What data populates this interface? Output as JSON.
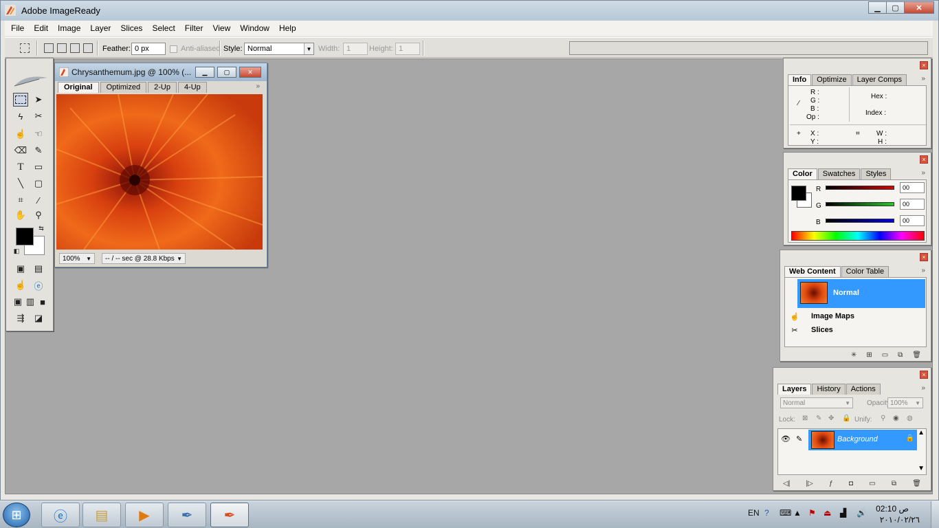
{
  "app": {
    "title": "Adobe ImageReady"
  },
  "window_controls": {
    "minimize": "▁",
    "maximize": "▢",
    "close": "✕"
  },
  "menu": [
    "File",
    "Edit",
    "Image",
    "Layer",
    "Slices",
    "Select",
    "Filter",
    "View",
    "Window",
    "Help"
  ],
  "options_bar": {
    "feather_label": "Feather:",
    "feather_value": "0 px",
    "anti_aliased_label": "Anti-aliased",
    "style_label": "Style:",
    "style_value": "Normal",
    "width_label": "Width:",
    "width_value": "1",
    "height_label": "Height:",
    "height_value": "1"
  },
  "document": {
    "title": "Chrysanthemum.jpg @ 100% (...",
    "tabs": [
      "Original",
      "Optimized",
      "2-Up",
      "4-Up"
    ],
    "zoom": "100%",
    "status": "-- / -- sec @ 28.8 Kbps"
  },
  "info_palette": {
    "tabs": [
      "Info",
      "Optimize",
      "Layer Comps"
    ],
    "rgbop": [
      "R :",
      "G :",
      "B :",
      "Op :"
    ],
    "hex": "Hex :",
    "index": "Index :",
    "xy": [
      "X :",
      "Y :"
    ],
    "wh": [
      "W :",
      "H :"
    ]
  },
  "color_palette": {
    "tabs": [
      "Color",
      "Swatches",
      "Styles"
    ],
    "channels": [
      {
        "label": "R",
        "value": "00",
        "color": "#cc0000"
      },
      {
        "label": "G",
        "value": "00",
        "color": "#22aa22"
      },
      {
        "label": "B",
        "value": "00",
        "color": "#0000cc"
      }
    ]
  },
  "web_content": {
    "tabs": [
      "Web Content",
      "Color Table"
    ],
    "items": [
      "Normal",
      "Image Maps",
      "Slices"
    ]
  },
  "layers": {
    "tabs": [
      "Layers",
      "History",
      "Actions"
    ],
    "blend_mode": "Normal",
    "opacity_label": "Opacity:",
    "opacity_value": "100%",
    "lock_label": "Lock:",
    "unify_label": "Unify:",
    "layer_name": "Background"
  },
  "taskbar": {
    "language": "EN",
    "time": "02:10 ص",
    "date": "٢٠١٠/٠٢/٢٦"
  },
  "colors": {
    "accent": "#3399ff",
    "selection": "#4aa3f0"
  }
}
